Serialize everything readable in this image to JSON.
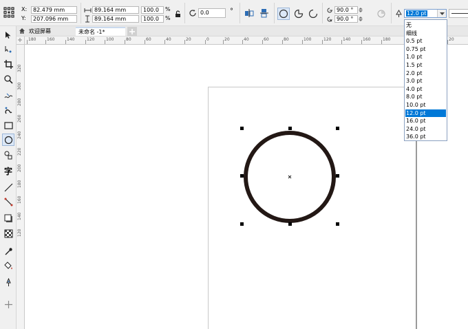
{
  "propbar": {
    "x_label": "X:",
    "x_value": "82.479 mm",
    "y_label": "Y:",
    "y_value": "207.096 mm",
    "width_value": "89.164 mm",
    "height_value": "89.164 mm",
    "scale_w": "100.0",
    "scale_h": "100.0",
    "percent": "%",
    "rotation_value": "0.0",
    "degree_sign": "°",
    "start_angle": "90.0 °",
    "end_angle": "90.0 °",
    "outline_width": "12.0 pt"
  },
  "tabs": [
    {
      "label": "欢迎屏幕"
    },
    {
      "label": "未命名 -1*"
    }
  ],
  "ruler": {
    "h_ticks": [
      "180",
      "160",
      "140",
      "120",
      "100",
      "80",
      "60",
      "40",
      "20",
      "0",
      "20",
      "40",
      "60",
      "80",
      "100",
      "120",
      "140",
      "160",
      "180",
      "20"
    ],
    "v_ticks": [
      "320",
      "300",
      "280",
      "260",
      "240",
      "220",
      "200",
      "180",
      "160",
      "140",
      "120"
    ]
  },
  "outline_options": [
    "无",
    "细线",
    "0.5 pt",
    "0.75 pt",
    "1.0 pt",
    "1.5 pt",
    "2.0 pt",
    "3.0 pt",
    "4.0 pt",
    "8.0 pt",
    "10.0 pt",
    "12.0 pt",
    "16.0 pt",
    "24.0 pt",
    "36.0 pt"
  ],
  "selected_outline": "12.0 pt",
  "colors": {
    "accent": "#0078d7",
    "circle_stroke": "#231815"
  }
}
